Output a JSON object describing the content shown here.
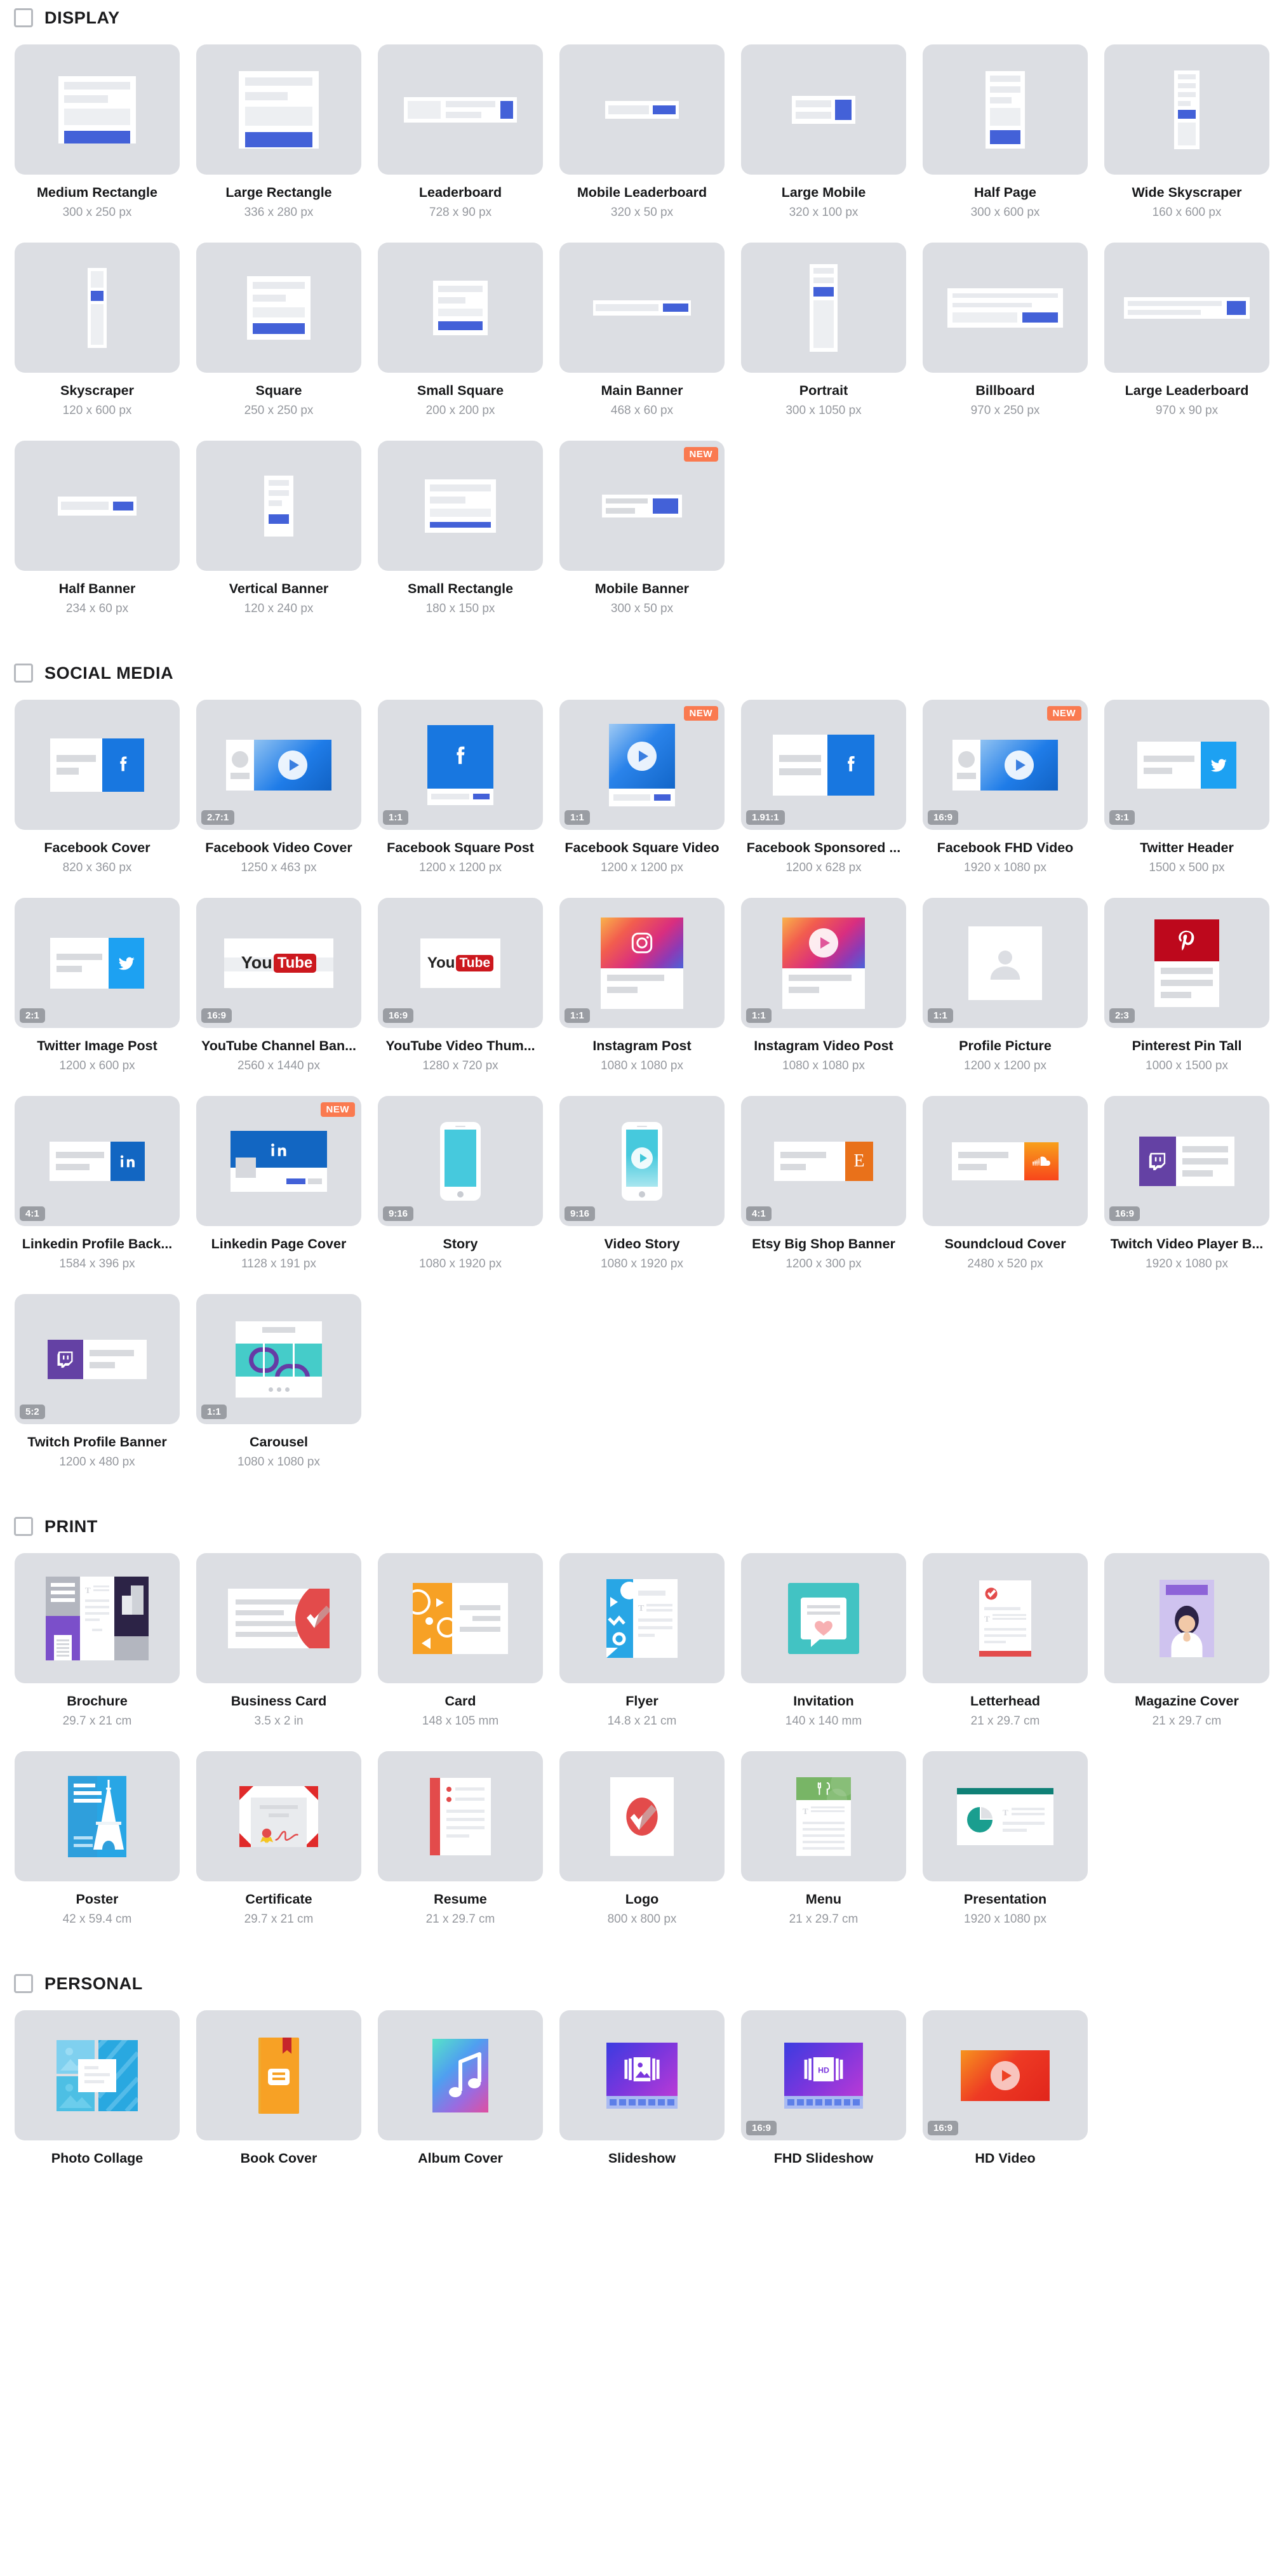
{
  "sections": [
    {
      "id": "display",
      "title": "DISPLAY",
      "checkbox_icon": "checkbox-unchecked-icon",
      "items": [
        {
          "name": "Medium Rectangle",
          "size": "300 x 250 px",
          "art": "mr",
          "ratio": "",
          "new": false
        },
        {
          "name": "Large Rectangle",
          "size": "336 x 280 px",
          "art": "lr",
          "ratio": "",
          "new": false
        },
        {
          "name": "Leaderboard",
          "size": "728 x 90 px",
          "art": "lb",
          "ratio": "",
          "new": false
        },
        {
          "name": "Mobile Leaderboard",
          "size": "320 x 50 px",
          "art": "mlb",
          "ratio": "",
          "new": false
        },
        {
          "name": "Large Mobile",
          "size": "320 x 100 px",
          "art": "lm",
          "ratio": "",
          "new": false
        },
        {
          "name": "Half Page",
          "size": "300 x 600 px",
          "art": "hp",
          "ratio": "",
          "new": false
        },
        {
          "name": "Wide Skyscraper",
          "size": "160 x 600 px",
          "art": "wsky",
          "ratio": "",
          "new": false
        },
        {
          "name": "Skyscraper",
          "size": "120 x 600 px",
          "art": "sky",
          "ratio": "",
          "new": false
        },
        {
          "name": "Square",
          "size": "250 x 250 px",
          "art": "sq",
          "ratio": "",
          "new": false
        },
        {
          "name": "Small Square",
          "size": "200 x 200 px",
          "art": "ssq",
          "ratio": "",
          "new": false
        },
        {
          "name": "Main Banner",
          "size": "468 x 60 px",
          "art": "mb",
          "ratio": "",
          "new": false
        },
        {
          "name": "Portrait",
          "size": "300 x 1050 px",
          "art": "pt",
          "ratio": "",
          "new": false
        },
        {
          "name": "Billboard",
          "size": "970 x 250 px",
          "art": "bb",
          "ratio": "",
          "new": false
        },
        {
          "name": "Large Leaderboard",
          "size": "970 x 90 px",
          "art": "llb",
          "ratio": "",
          "new": false
        },
        {
          "name": "Half Banner",
          "size": "234 x 60 px",
          "art": "hb",
          "ratio": "",
          "new": false
        },
        {
          "name": "Vertical Banner",
          "size": "120 x 240 px",
          "art": "vb",
          "ratio": "",
          "new": false
        },
        {
          "name": "Small Rectangle",
          "size": "180 x 150 px",
          "art": "sr",
          "ratio": "",
          "new": false
        },
        {
          "name": "Mobile Banner",
          "size": "300 x 50 px",
          "art": "mbn",
          "ratio": "",
          "new": true
        }
      ]
    },
    {
      "id": "social-media",
      "title": "SOCIAL MEDIA",
      "checkbox_icon": "checkbox-unchecked-icon",
      "items": [
        {
          "name": "Facebook Cover",
          "size": "820 x 360 px",
          "art": "fb-cover",
          "ratio": "",
          "new": false
        },
        {
          "name": "Facebook Video Cover",
          "size": "1250 x 463 px",
          "art": "fb-video-cover",
          "ratio": "2.7:1",
          "new": false
        },
        {
          "name": "Facebook Square Post",
          "size": "1200 x 1200 px",
          "art": "fb-square-post",
          "ratio": "1:1",
          "new": false
        },
        {
          "name": "Facebook Square Video",
          "size": "1200 x 1200 px",
          "art": "fb-square-video",
          "ratio": "1:1",
          "new": true
        },
        {
          "name": "Facebook Sponsored ...",
          "size": "1200 x 628 px",
          "art": "fb-sponsored",
          "ratio": "1.91:1",
          "new": false
        },
        {
          "name": "Facebook FHD Video",
          "size": "1920 x 1080 px",
          "art": "fb-fhd-video",
          "ratio": "16:9",
          "new": true
        },
        {
          "name": "Twitter Header",
          "size": "1500 x 500 px",
          "art": "tw-header",
          "ratio": "3:1",
          "new": false
        },
        {
          "name": "Twitter Image Post",
          "size": "1200 x 600 px",
          "art": "tw-image-post",
          "ratio": "2:1",
          "new": false
        },
        {
          "name": "YouTube Channel Ban...",
          "size": "2560 x 1440 px",
          "art": "yt-channel",
          "ratio": "16:9",
          "new": false
        },
        {
          "name": "YouTube Video Thum...",
          "size": "1280 x 720 px",
          "art": "yt-thumb",
          "ratio": "16:9",
          "new": false
        },
        {
          "name": "Instagram Post",
          "size": "1080 x 1080 px",
          "art": "ig-post",
          "ratio": "1:1",
          "new": false
        },
        {
          "name": "Instagram Video Post",
          "size": "1080 x 1080 px",
          "art": "ig-video",
          "ratio": "1:1",
          "new": false
        },
        {
          "name": "Profile Picture",
          "size": "1200 x 1200 px",
          "art": "profile-pic",
          "ratio": "1:1",
          "new": false
        },
        {
          "name": "Pinterest Pin Tall",
          "size": "1000 x 1500 px",
          "art": "pin-tall",
          "ratio": "2:3",
          "new": false
        },
        {
          "name": "Linkedin Profile Back...",
          "size": "1584 x 396 px",
          "art": "li-profile",
          "ratio": "4:1",
          "new": false
        },
        {
          "name": "Linkedin Page Cover",
          "size": "1128 x 191 px",
          "art": "li-page",
          "ratio": "",
          "new": true
        },
        {
          "name": "Story",
          "size": "1080 x 1920 px",
          "art": "story",
          "ratio": "9:16",
          "new": false
        },
        {
          "name": "Video Story",
          "size": "1080 x 1920 px",
          "art": "video-story",
          "ratio": "9:16",
          "new": false
        },
        {
          "name": "Etsy Big Shop Banner",
          "size": "1200 x 300 px",
          "art": "etsy",
          "ratio": "4:1",
          "new": false
        },
        {
          "name": "Soundcloud Cover",
          "size": "2480 x 520 px",
          "art": "soundcloud",
          "ratio": "",
          "new": false
        },
        {
          "name": "Twitch Video Player B...",
          "size": "1920 x 1080 px",
          "art": "twitch-video",
          "ratio": "16:9",
          "new": false
        },
        {
          "name": "Twitch Profile Banner",
          "size": "1200 x 480 px",
          "art": "twitch-profile",
          "ratio": "5:2",
          "new": false
        },
        {
          "name": "Carousel",
          "size": "1080 x 1080 px",
          "art": "carousel",
          "ratio": "1:1",
          "new": false
        }
      ]
    },
    {
      "id": "print",
      "title": "PRINT",
      "checkbox_icon": "checkbox-unchecked-icon",
      "items": [
        {
          "name": "Brochure",
          "size": "29.7 x 21 cm",
          "art": "brochure",
          "ratio": "",
          "new": false
        },
        {
          "name": "Business Card",
          "size": "3.5 x 2 in",
          "art": "business-card",
          "ratio": "",
          "new": false
        },
        {
          "name": "Card",
          "size": "148 x 105 mm",
          "art": "card",
          "ratio": "",
          "new": false
        },
        {
          "name": "Flyer",
          "size": "14.8 x 21 cm",
          "art": "flyer",
          "ratio": "",
          "new": false
        },
        {
          "name": "Invitation",
          "size": "140 x 140 mm",
          "art": "invitation",
          "ratio": "",
          "new": false
        },
        {
          "name": "Letterhead",
          "size": "21 x 29.7 cm",
          "art": "letterhead",
          "ratio": "",
          "new": false
        },
        {
          "name": "Magazine Cover",
          "size": "21 x 29.7 cm",
          "art": "magazine",
          "ratio": "",
          "new": false
        },
        {
          "name": "Poster",
          "size": "42 x 59.4 cm",
          "art": "poster",
          "ratio": "",
          "new": false
        },
        {
          "name": "Certificate",
          "size": "29.7 x 21 cm",
          "art": "certificate",
          "ratio": "",
          "new": false
        },
        {
          "name": "Resume",
          "size": "21 x 29.7 cm",
          "art": "resume",
          "ratio": "",
          "new": false
        },
        {
          "name": "Logo",
          "size": "800 x 800 px",
          "art": "logo",
          "ratio": "",
          "new": false
        },
        {
          "name": "Menu",
          "size": "21 x 29.7 cm",
          "art": "menu",
          "ratio": "",
          "new": false
        },
        {
          "name": "Presentation",
          "size": "1920 x 1080 px",
          "art": "presentation",
          "ratio": "",
          "new": false
        }
      ]
    },
    {
      "id": "personal",
      "title": "PERSONAL",
      "checkbox_icon": "checkbox-unchecked-icon",
      "items": [
        {
          "name": "Photo Collage",
          "size": "",
          "art": "collage",
          "ratio": "",
          "new": false
        },
        {
          "name": "Book Cover",
          "size": "",
          "art": "book",
          "ratio": "",
          "new": false
        },
        {
          "name": "Album Cover",
          "size": "",
          "art": "album",
          "ratio": "",
          "new": false
        },
        {
          "name": "Slideshow",
          "size": "",
          "art": "slideshow",
          "ratio": "",
          "new": false
        },
        {
          "name": "FHD Slideshow",
          "size": "",
          "art": "fhd-slideshow",
          "ratio": "16:9",
          "new": false
        },
        {
          "name": "HD Video",
          "size": "",
          "art": "hd-video",
          "ratio": "16:9",
          "new": false
        }
      ]
    }
  ],
  "labels": {
    "new_badge": "NEW"
  },
  "colors": {
    "card_bg": "#dcdee3",
    "accent_blue": "#4361d8",
    "badge_new": "#fa7a50",
    "badge_ratio": "#9a9da3",
    "facebook": "#1877e0",
    "twitter": "#1da1f2",
    "linkedin": "#1266c2",
    "youtube": "#cc181e",
    "pinterest": "#bd081c",
    "twitch": "#6441a4",
    "etsy": "#e9711a",
    "teal": "#3fc6d8"
  }
}
